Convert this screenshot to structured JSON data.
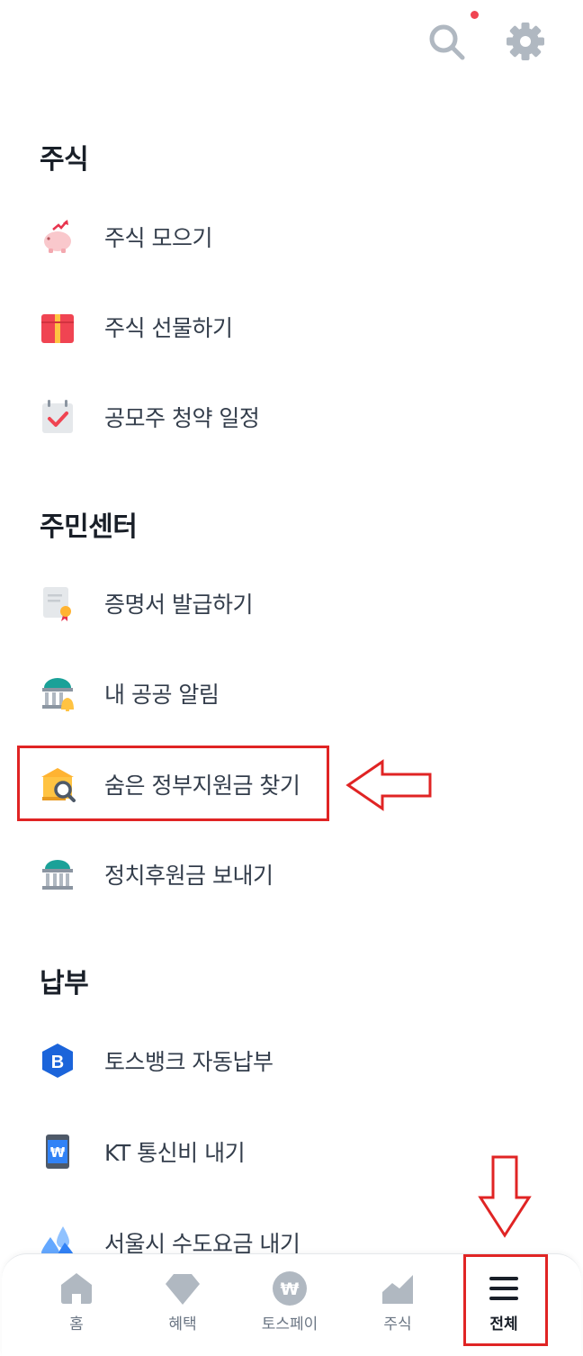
{
  "sections": [
    {
      "title": "주식",
      "items": [
        {
          "label": "주식 모으기",
          "icon": "piggy-bank-icon"
        },
        {
          "label": "주식 선물하기",
          "icon": "gift-icon"
        },
        {
          "label": "공모주 청약 일정",
          "icon": "calendar-check-icon"
        }
      ]
    },
    {
      "title": "주민센터",
      "items": [
        {
          "label": "증명서 발급하기",
          "icon": "certificate-icon"
        },
        {
          "label": "내 공공 알림",
          "icon": "government-bell-icon"
        },
        {
          "label": "숨은 정부지원금 찾기",
          "icon": "government-search-icon"
        },
        {
          "label": "정치후원금 보내기",
          "icon": "government-building-icon"
        }
      ]
    },
    {
      "title": "납부",
      "items": [
        {
          "label": "토스뱅크 자동납부",
          "icon": "tossbank-b-icon"
        },
        {
          "label": "KT 통신비 내기",
          "icon": "phone-won-icon"
        },
        {
          "label": "서울시 수도요금 내기",
          "icon": "water-drops-icon"
        }
      ]
    }
  ],
  "bottom_nav": {
    "tabs": [
      {
        "label": "홈",
        "icon": "home-icon"
      },
      {
        "label": "혜택",
        "icon": "benefit-diamond-icon"
      },
      {
        "label": "토스페이",
        "icon": "tosspay-won-icon"
      },
      {
        "label": "주식",
        "icon": "stock-chart-icon"
      },
      {
        "label": "전체",
        "icon": "menu-icon"
      }
    ],
    "active": "전체"
  },
  "colors": {
    "annotation": "#e02424",
    "icon_gray": "#b0b8c1",
    "text_primary": "#191f28",
    "text_secondary": "#333d4b"
  }
}
